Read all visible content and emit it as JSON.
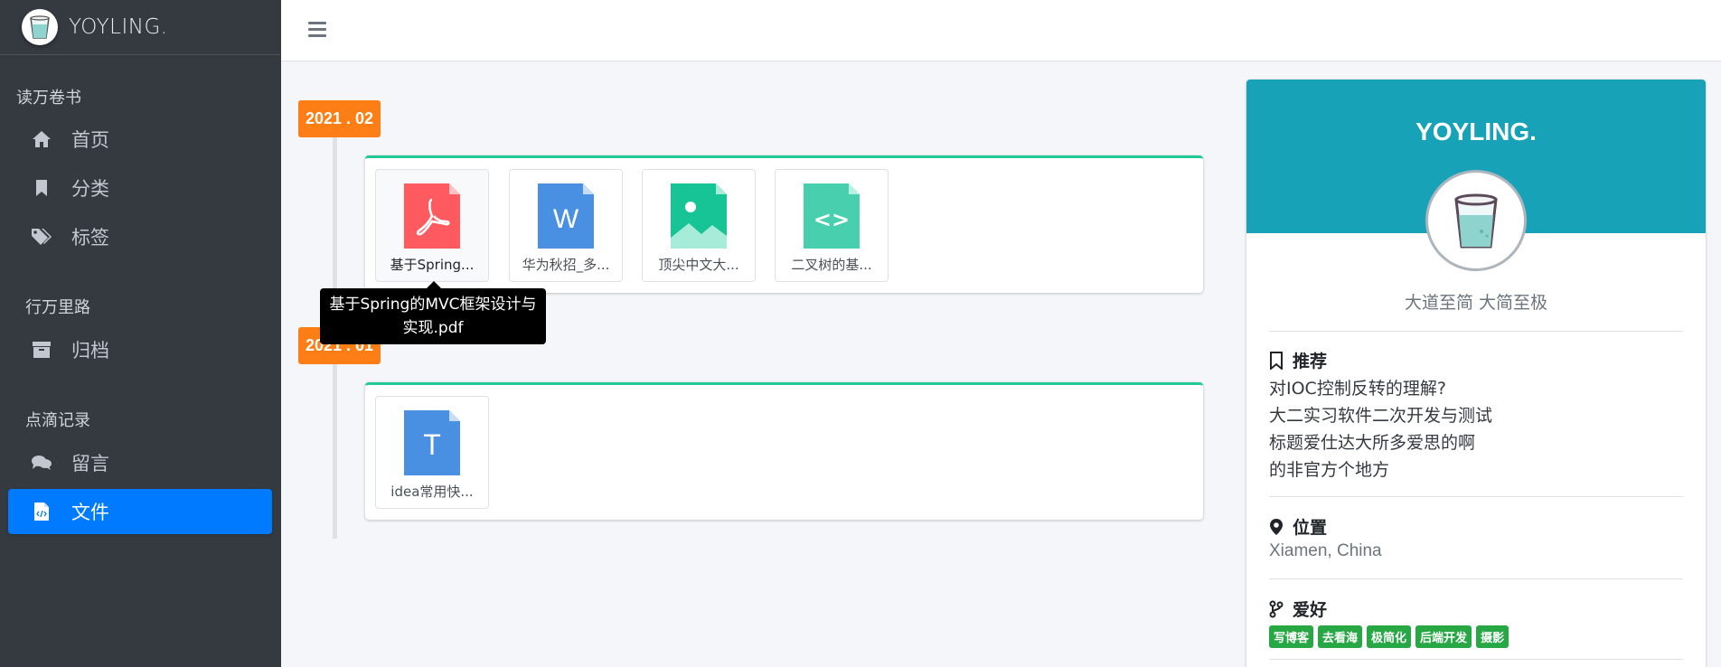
{
  "brand": {
    "name": "YOYLING."
  },
  "sidebar": {
    "headers": [
      "读万卷书",
      "行万里路",
      "点滴记录"
    ],
    "items": [
      {
        "label": "首页",
        "icon": "home-icon"
      },
      {
        "label": "分类",
        "icon": "bookmark-icon"
      },
      {
        "label": "标签",
        "icon": "tags-icon"
      },
      {
        "label": "归档",
        "icon": "archive-icon"
      },
      {
        "label": "留言",
        "icon": "comments-icon"
      },
      {
        "label": "文件",
        "icon": "file-code-icon",
        "active": true
      }
    ]
  },
  "timeline": {
    "groups": [
      {
        "date": "2021 . 02",
        "files": [
          {
            "name": "基于Spring...",
            "type": "pdf",
            "color": "#ff5a5f",
            "glyph": "pdf"
          },
          {
            "name": "华为秋招_多...",
            "type": "word",
            "color": "#4a90e2",
            "glyph": "W"
          },
          {
            "name": "顶尖中文大...",
            "type": "image",
            "color": "#17c495",
            "glyph": "img"
          },
          {
            "name": "二叉树的基...",
            "type": "code",
            "color": "#48cfad",
            "glyph": "<>"
          }
        ]
      },
      {
        "date": "2021 . 01",
        "files": [
          {
            "name": "idea常用快...",
            "type": "text",
            "color": "#4a90e2",
            "glyph": "T"
          }
        ]
      }
    ],
    "tooltip": {
      "line1": "基于Spring的MVC框架设计与",
      "line2": "实现.pdf"
    }
  },
  "profile": {
    "name": "YOYLING.",
    "motto": "大道至简 大简至极",
    "recommend_title": "推荐",
    "recommend": [
      "对IOC控制反转的理解?",
      "大二实习软件二次开发与测试",
      "标题爱仕达大所多爱思的啊",
      "的非官方个地方"
    ],
    "location_title": "位置",
    "location": "Xiamen, China",
    "hobby_title": "爱好",
    "hobbies": [
      "写博客",
      "去看海",
      "极简化",
      "后端开发",
      "摄影"
    ]
  },
  "colors": {
    "sidebar": "#343a40",
    "active": "#007bff",
    "accent_profile": "#17a2b8",
    "date_badge": "#fd7e14",
    "tag": "#28a745"
  }
}
